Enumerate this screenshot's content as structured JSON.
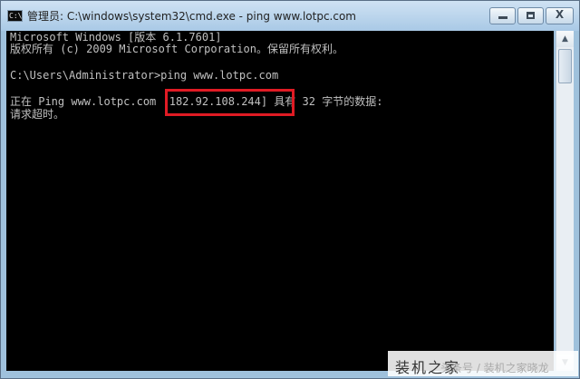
{
  "window": {
    "title": "管理员: C:\\windows\\system32\\cmd.exe - ping  www.lotpc.com",
    "icon_label": "C:\\",
    "close_label": "X"
  },
  "console": {
    "lines": [
      "Microsoft Windows [版本 6.1.7601]",
      "版权所有 (c) 2009 Microsoft Corporation。保留所有权利。",
      "C:\\Users\\Administrator>ping www.lotpc.com",
      "正在 Ping www.lotpc.com [182.92.108.244] 具有 32 字节的数据:",
      "请求超时。"
    ]
  },
  "scrollbar": {
    "up_arrow": "▲",
    "down_arrow": "▼"
  },
  "watermark": {
    "text": "装机之家",
    "subtext": "头条号 / 装机之家晓龙"
  }
}
